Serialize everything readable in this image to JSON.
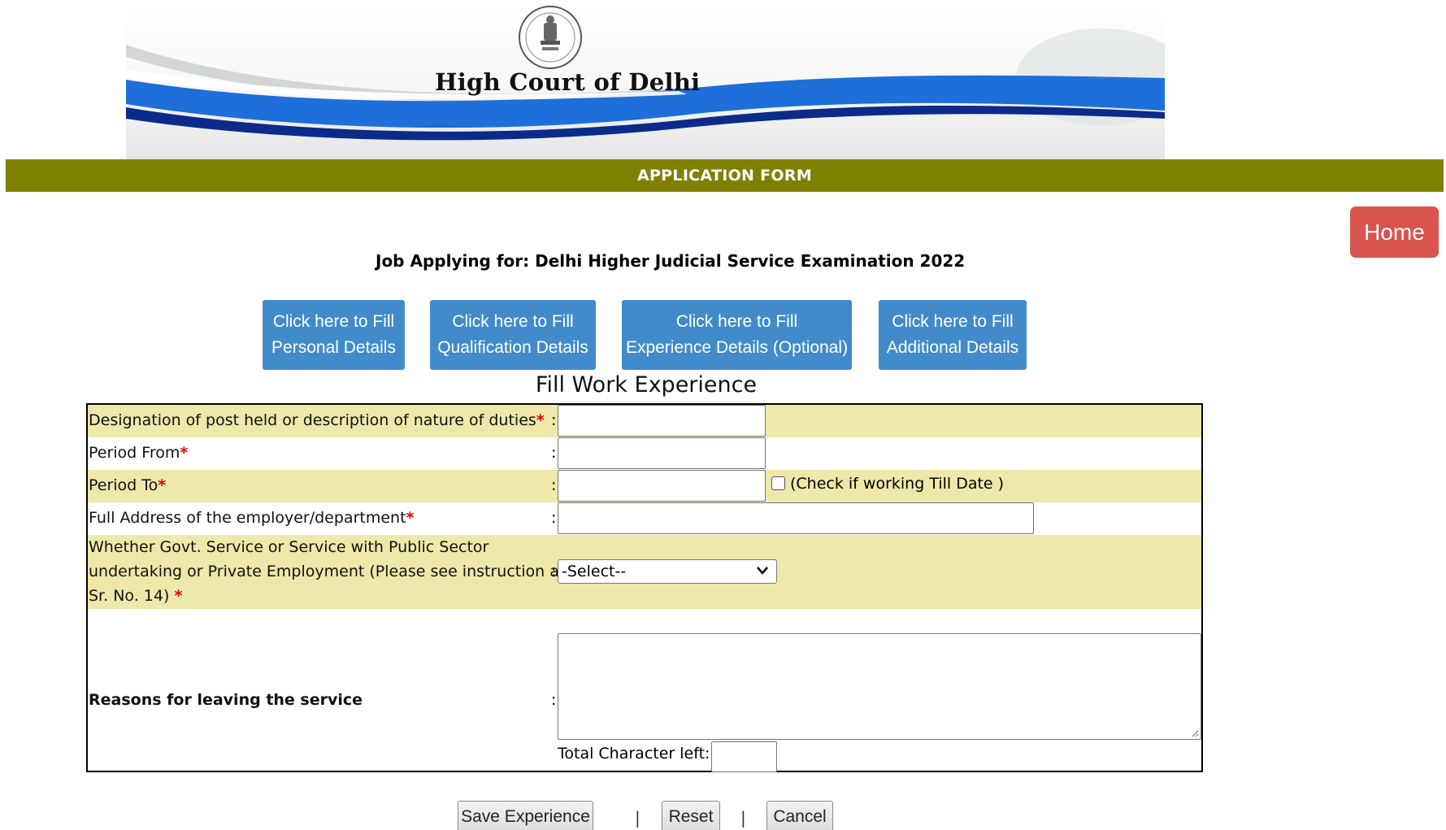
{
  "header": {
    "court_title": "High Court of Delhi",
    "form_bar": "APPLICATION FORM",
    "home_label": "Home"
  },
  "job": {
    "prefix": "Job Applying for:",
    "title": "Delhi Higher Judicial Service Examination 2022"
  },
  "nav": {
    "personal": [
      "Click here to Fill",
      "Personal Details"
    ],
    "qualification": [
      "Click here to Fill",
      "Qualification Details"
    ],
    "experience": [
      "Click here to Fill",
      "Experience Details (Optional)"
    ],
    "additional": [
      "Click here to Fill",
      "Additional Details"
    ]
  },
  "section_title": "Fill Work Experience",
  "form": {
    "designation_label": "Designation of post held or description of nature of duties",
    "period_from_label": "Period From",
    "period_to_label": "Period To",
    "till_date_label": "(Check if working Till Date )",
    "address_label": "Full Address of the employer/department",
    "service_type_label_1": "Whether Govt. Service or Service with Public Sector",
    "service_type_label_2": "undertaking or Private Employment (Please see instruction at",
    "service_type_label_3": "Sr. No. 14)",
    "service_type_selected": "-Select--",
    "reasons_label": "Reasons for leaving the service",
    "chars_left_label": "Total Character left:",
    "required_mark": "*",
    "colon": ":",
    "designation_value": "",
    "period_from_value": "",
    "period_to_value": "",
    "address_value": "",
    "reasons_value": "",
    "chars_left_value": ""
  },
  "actions": {
    "save": "Save Experience",
    "reset": "Reset",
    "cancel": "Cancel",
    "separator": "|"
  },
  "colors": {
    "form_bar": "#808000",
    "home_button": "#d9534f",
    "nav_button": "#428bca",
    "row_highlight": "#eee8aa",
    "required": "#e00000"
  },
  "icons": {
    "emblem": "court-emblem-icon",
    "dropdown": "chevron-down-icon",
    "resize": "resize-handle-icon"
  }
}
